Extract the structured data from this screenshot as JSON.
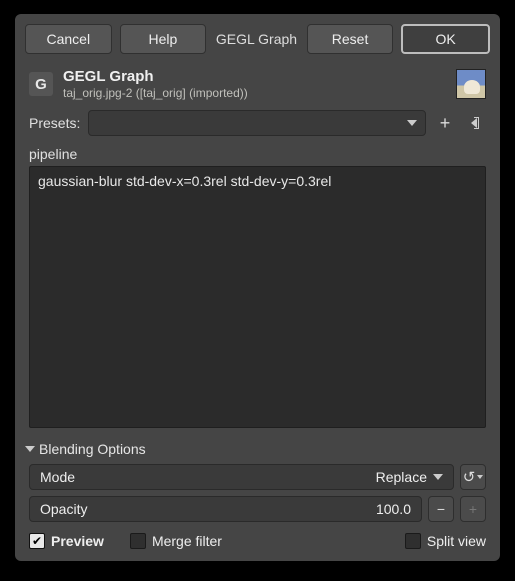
{
  "topbar": {
    "cancel": "Cancel",
    "help": "Help",
    "title": "GEGL Graph",
    "reset": "Reset",
    "ok": "OK"
  },
  "header": {
    "title": "GEGL Graph",
    "subtitle": "taj_orig.jpg-2 ([taj_orig] (imported))"
  },
  "presets": {
    "label": "Presets:",
    "value": ""
  },
  "pipeline": {
    "label": "pipeline",
    "value": "gaussian-blur std-dev-x=0.3rel std-dev-y=0.3rel"
  },
  "blend": {
    "title": "Blending Options",
    "mode_label": "Mode",
    "mode_value": "Replace",
    "opacity_label": "Opacity",
    "opacity_value": "100.0"
  },
  "footer": {
    "preview": "Preview",
    "merge_filter": "Merge filter",
    "split_view": "Split view",
    "preview_checked": true,
    "merge_filter_checked": false,
    "split_view_checked": false
  }
}
